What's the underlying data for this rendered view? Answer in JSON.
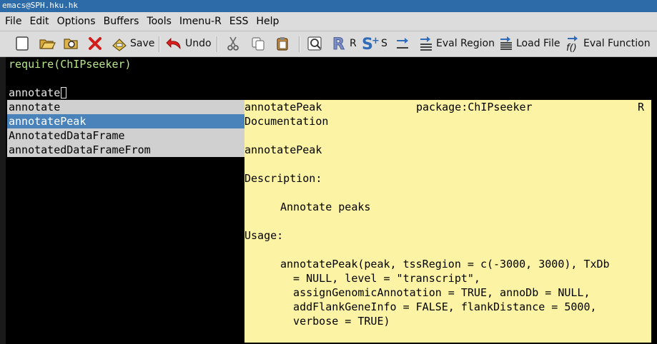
{
  "window": {
    "title": "emacs@SPH.hku.hk"
  },
  "menubar": {
    "items": [
      "File",
      "Edit",
      "Options",
      "Buffers",
      "Tools",
      "Imenu-R",
      "ESS",
      "Help"
    ]
  },
  "toolbar": {
    "save_label": "Save",
    "undo_label": "Undo",
    "r_label": "R",
    "s_label": "S",
    "eval_region_label": "Eval Region",
    "load_file_label": "Load File",
    "eval_function_label": "Eval Function"
  },
  "editor": {
    "line1": "require(ChIPseeker)",
    "line3": "annotate"
  },
  "completion": {
    "items": [
      {
        "label": "annotate",
        "selected": false
      },
      {
        "label": "annotatePeak",
        "selected": true
      },
      {
        "label": "AnnotatedDataFrame",
        "selected": false
      },
      {
        "label": "annotatedDataFrameFrom",
        "selected": false
      }
    ]
  },
  "doc": {
    "topic": "annotatePeak",
    "package": "package:ChIPseeker",
    "r": "R",
    "documentation": "Documentation",
    "name": "annotatePeak",
    "description_heading": "Description:",
    "description": "Annotate peaks",
    "usage_heading": "Usage:",
    "usage": [
      "annotatePeak(peak, tssRegion = c(-3000, 3000), TxDb",
      "  = NULL, level = \"transcript\",",
      "  assignGenomicAnnotation = TRUE, annoDb = NULL,",
      "  addFlankGeneInfo = FALSE, flankDistance = 5000,",
      "  verbose = TRUE)"
    ]
  }
}
